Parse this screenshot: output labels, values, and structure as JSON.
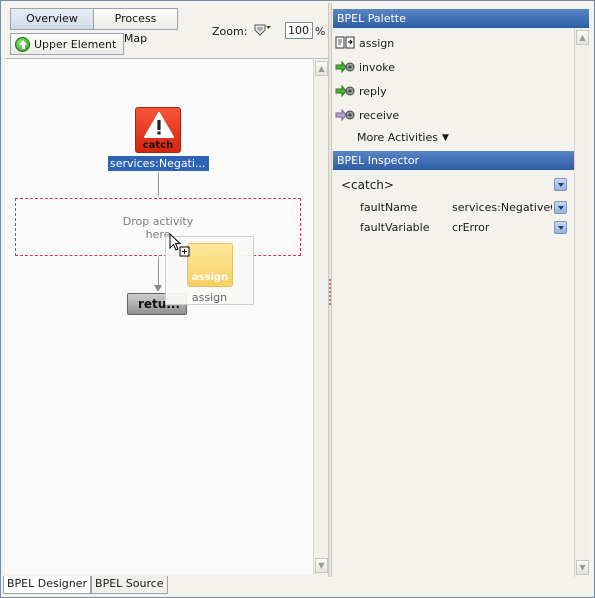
{
  "designer": {
    "tabs": [
      {
        "label": "Overview"
      },
      {
        "label": "Process Map"
      }
    ],
    "upper_element_label": "Upper Element",
    "zoom": {
      "label": "Zoom:",
      "value": "100",
      "unit": "%"
    },
    "canvas": {
      "catch_node_label": "catch",
      "catch_node_name": "services:Negati...",
      "drop_zone_line1": "Drop activity",
      "drop_zone_line2": "here",
      "return_node_label": "retu...",
      "drag_preview_icon_label": "assign",
      "drag_preview_label": "assign"
    },
    "bottom_tabs": [
      {
        "label": "BPEL Designer"
      },
      {
        "label": "BPEL Source"
      }
    ]
  },
  "palette": {
    "title": "BPEL Palette",
    "items": [
      {
        "label": "assign",
        "icon": "assign-icon"
      },
      {
        "label": "invoke",
        "icon": "invoke-icon"
      },
      {
        "label": "reply",
        "icon": "reply-icon"
      },
      {
        "label": "receive",
        "icon": "receive-icon"
      }
    ],
    "more_label": "More Activities"
  },
  "inspector": {
    "title": "BPEL Inspector",
    "element": "<catch>",
    "rows": [
      {
        "key": "faultName",
        "value": "services:NegativeCredit"
      },
      {
        "key": "faultVariable",
        "value": "crError"
      }
    ]
  },
  "colors": {
    "header_blue": "#2d5ca6",
    "catch_red": "#d5250e",
    "selection_blue": "#2f63b5",
    "drop_zone_red": "#d13a3a"
  }
}
